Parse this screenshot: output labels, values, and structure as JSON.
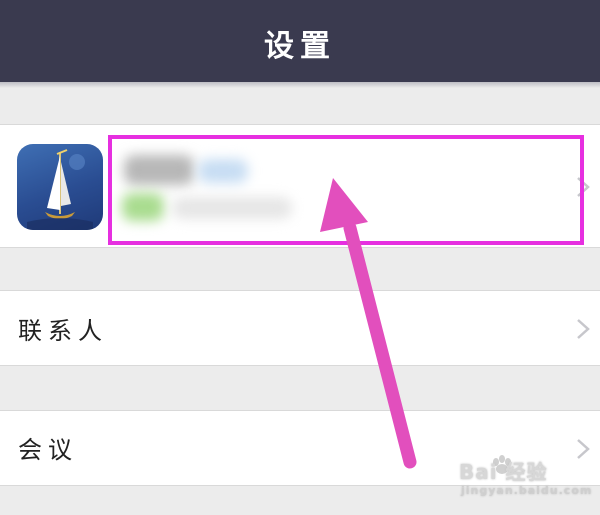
{
  "navbar": {
    "title": "设置"
  },
  "profile": {
    "avatar_icon": "sailboat-app-icon",
    "chevron_icon": "chevron-right-icon"
  },
  "rows": [
    {
      "label": "联系人",
      "chevron_icon": "chevron-right-icon"
    },
    {
      "label": "会议",
      "chevron_icon": "chevron-right-icon"
    }
  ],
  "annotation": {
    "highlight_color": "#e62fe0",
    "arrow_color": "#e24fbd"
  },
  "watermark": {
    "text": "Bai 经验",
    "url": "jingyan.baidu.com"
  },
  "colors": {
    "navbar_bg": "#3a3a4f",
    "page_bg": "#ececec",
    "cell_bg": "#ffffff"
  }
}
